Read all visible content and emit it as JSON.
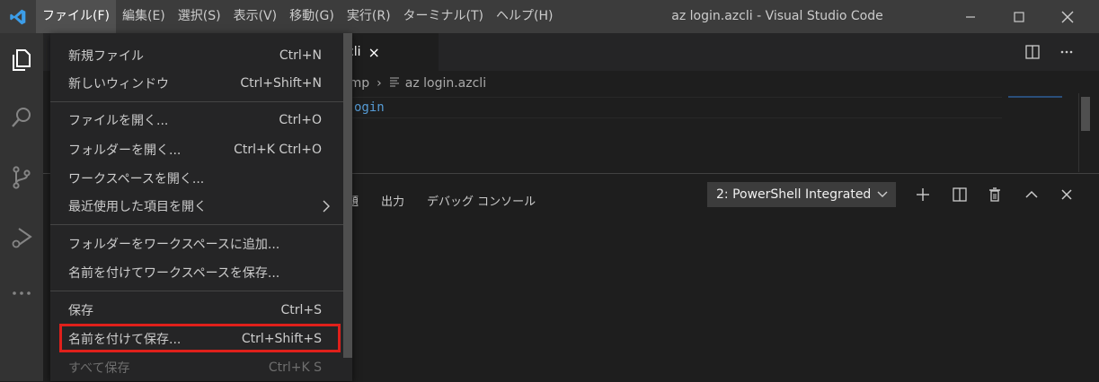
{
  "colors": {
    "accent": "#3c9de8",
    "titlebar": "#3c3c3c",
    "highlight_border": "#e0201b",
    "code_keyword": "#569cd6"
  },
  "titlebar": {
    "app_icon": "vscode-logo-icon",
    "menus": [
      "ファイル(F)",
      "編集(E)",
      "選択(S)",
      "表示(V)",
      "移動(G)",
      "実行(R)",
      "ターミナル(T)",
      "ヘルプ(H)"
    ],
    "window_title": "az login.azcli - Visual Studio Code",
    "controls": [
      "minimize-icon",
      "maximize-icon",
      "close-icon"
    ]
  },
  "activitybar": {
    "items": [
      "files-icon",
      "search-icon",
      "source-control-icon",
      "run-debug-icon",
      "more-icon"
    ]
  },
  "editor": {
    "tab_label": "cli",
    "tab_close": "×",
    "breadcrumb_part": "emp",
    "breadcrumb_sep": "›",
    "breadcrumb_file": "az login.azcli",
    "code_text": "ogin",
    "actions": [
      "split-editor-icon",
      "more-actions-icon"
    ]
  },
  "panel": {
    "tabs": [
      "題",
      "出力",
      "デバッグ コンソール"
    ],
    "terminal_select": "2: PowerShell Integrated",
    "icons": [
      "add-terminal-icon",
      "split-terminal-icon",
      "trash-icon",
      "maximize-panel-icon",
      "close-panel-icon"
    ]
  },
  "file_menu": {
    "items": [
      {
        "label": "新規ファイル",
        "shortcut": "Ctrl+N"
      },
      {
        "label": "新しいウィンドウ",
        "shortcut": "Ctrl+Shift+N"
      },
      {
        "label": "ファイルを開く...",
        "shortcut": "Ctrl+O"
      },
      {
        "label": "フォルダーを開く...",
        "shortcut": "Ctrl+K Ctrl+O"
      },
      {
        "label": "ワークスペースを開く...",
        "shortcut": ""
      },
      {
        "label": "最近使用した項目を開く",
        "shortcut": ""
      },
      {
        "label": "フォルダーをワークスペースに追加...",
        "shortcut": ""
      },
      {
        "label": "名前を付けてワークスペースを保存...",
        "shortcut": ""
      },
      {
        "label": "保存",
        "shortcut": "Ctrl+S"
      },
      {
        "label": "名前を付けて保存...",
        "shortcut": "Ctrl+Shift+S"
      },
      {
        "label": "すべて保存",
        "shortcut": "Ctrl+K S"
      }
    ],
    "submenu_arrow": "›"
  }
}
